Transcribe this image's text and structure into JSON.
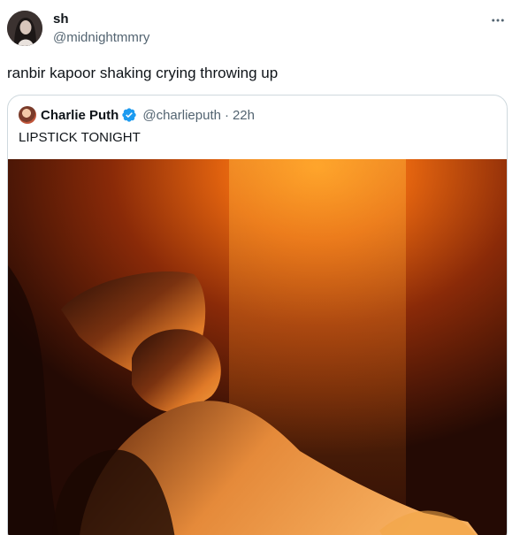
{
  "tweet": {
    "author": {
      "display_name": "sh",
      "handle": "@midnightmmry"
    },
    "text": "ranbir kapoor shaking crying throwing up"
  },
  "quoted_tweet": {
    "author": {
      "display_name": "Charlie Puth",
      "handle": "@charlieputh",
      "verified": true
    },
    "time": "22h",
    "separator": "·",
    "text": "LIPSTICK TONIGHT"
  },
  "icons": {
    "more": "more-horizontal-icon",
    "verified": "verified-badge-icon"
  },
  "colors": {
    "verified_blue": "#1d9bf0",
    "secondary_text": "#536471",
    "border": "#cfd9de"
  }
}
